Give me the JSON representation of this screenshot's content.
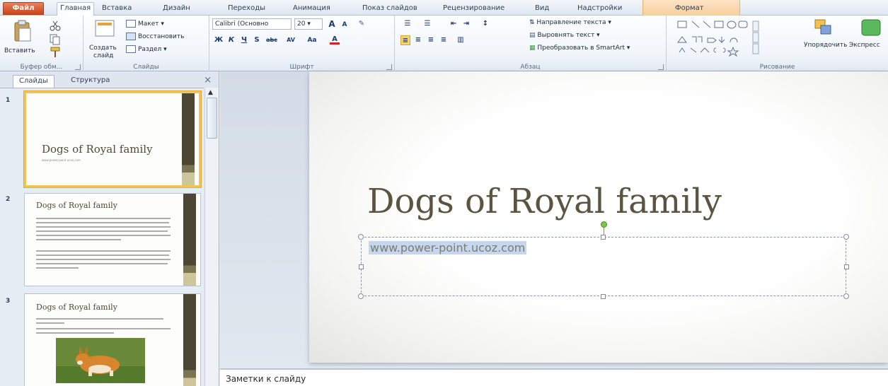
{
  "tabs": {
    "file": "Файл",
    "items": [
      "Главная",
      "Вставка",
      "Дизайн",
      "Переходы",
      "Анимация",
      "Показ слайдов",
      "Рецензирование",
      "Вид",
      "Надстройки"
    ],
    "context": "Формат"
  },
  "ribbon": {
    "clipboard": {
      "paste": "Вставить",
      "label": "Буфер обм..."
    },
    "slides": {
      "new_slide_1": "Создать",
      "new_slide_2": "слайд",
      "layout": "Макет",
      "reset": "Восстановить",
      "section": "Раздел",
      "label": "Слайды"
    },
    "font": {
      "name": "Calibri (Основно",
      "size": "20",
      "label": "Шрифт",
      "bold": "Ж",
      "italic": "К",
      "underline": "Ч",
      "strike": "S",
      "shadow": "abc",
      "spacing": "AV",
      "case": "Aa",
      "color": "A"
    },
    "paragraph": {
      "direction": "Направление текста",
      "align": "Выровнять текст",
      "smartart": "Преобразовать в SmartArt",
      "label": "Абзац"
    },
    "drawing": {
      "arrange": "Упорядочить",
      "quick": "Экспресс",
      "label": "Рисование"
    }
  },
  "panel": {
    "tab_slides": "Слайды",
    "tab_outline": "Структура",
    "close": "×",
    "thumbnails": [
      {
        "num": "1",
        "title": "Dogs of Royal family",
        "sub": "www.power-point.ucoz.com"
      },
      {
        "num": "2",
        "title": "Dogs of Royal family"
      },
      {
        "num": "3",
        "title": "Dogs of Royal family"
      }
    ]
  },
  "slide": {
    "title": "Dogs of Royal family",
    "subtitle": "www.power-point.ucoz.com"
  },
  "notes": {
    "placeholder": "Заметки к слайду"
  },
  "colors": {
    "accent_file": "#c6461b",
    "slide_title": "#5b5440",
    "selection": "#f2c453"
  }
}
